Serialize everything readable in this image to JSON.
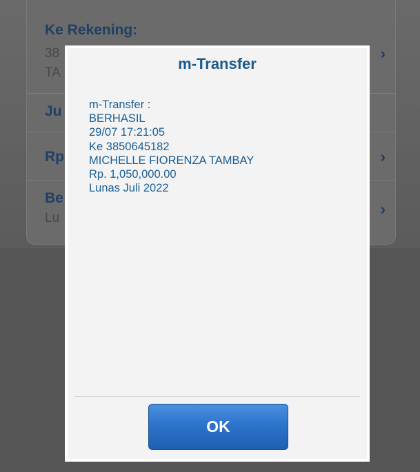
{
  "background_form": {
    "row1": {
      "title": "Ke Rekening:",
      "line1": "38",
      "line2": "TA"
    },
    "row2": {
      "title": "Ju"
    },
    "row3": {
      "title": "Rp"
    },
    "row4": {
      "title": "Be",
      "line1": "Lu"
    },
    "chevron": "›"
  },
  "dialog": {
    "title": "m-Transfer",
    "lines": [
      "m-Transfer :",
      "BERHASIL",
      "29/07 17:21:05",
      "Ke 3850645182",
      "MICHELLE FIORENZA TAMBAY",
      "Rp. 1,050,000.00",
      "Lunas Juli 2022"
    ],
    "ok_label": "OK"
  }
}
